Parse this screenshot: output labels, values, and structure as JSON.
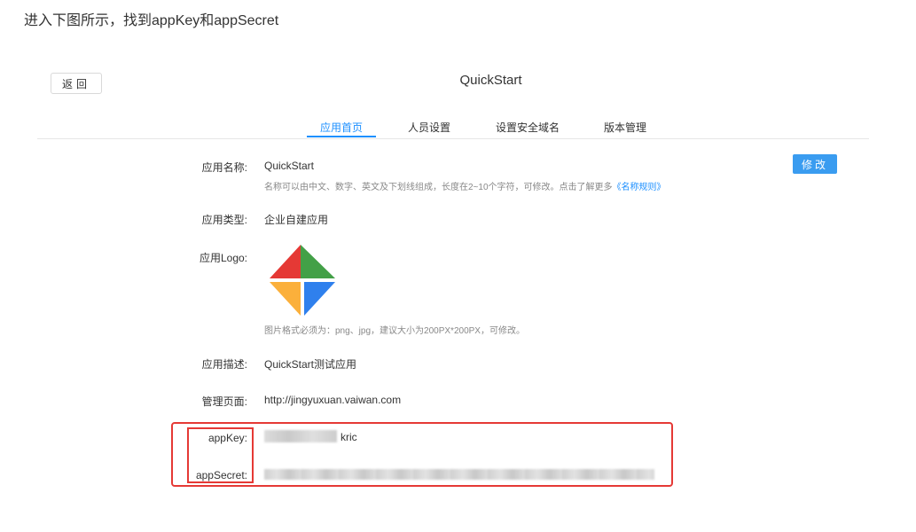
{
  "intro_text": "进入下图所示，找到appKey和appSecret",
  "header": {
    "back_label": "返回",
    "title": "QuickStart"
  },
  "tabs": [
    {
      "label": "应用首页",
      "active": true
    },
    {
      "label": "人员设置",
      "active": false
    },
    {
      "label": "设置安全域名",
      "active": false
    },
    {
      "label": "版本管理",
      "active": false
    }
  ],
  "form": {
    "edit_label": "修改",
    "name_label": "应用名称:",
    "name_value": "QuickStart",
    "name_hint": "名称可以由中文、数字、英文及下划线组成，长度在2~10个字符，可修改。点击了解更多",
    "name_hint_link": "《名称规则》",
    "type_label": "应用类型:",
    "type_value": "企业自建应用",
    "logo_label": "应用Logo:",
    "logo_hint": "图片格式必须为：png、jpg，建议大小为200PX*200PX，可修改。",
    "desc_label": "应用描述:",
    "desc_value": "QuickStart测试应用",
    "page_label": "管理页面:",
    "page_value": "http://jingyuxuan.vaiwan.com",
    "appkey_label": "appKey:",
    "appkey_visible_tail": "kric",
    "appsecret_label": "appSecret:"
  },
  "colors": {
    "accent": "#1e90ff",
    "highlight_box": "#e53935",
    "edit_button": "#3a9cf0"
  }
}
